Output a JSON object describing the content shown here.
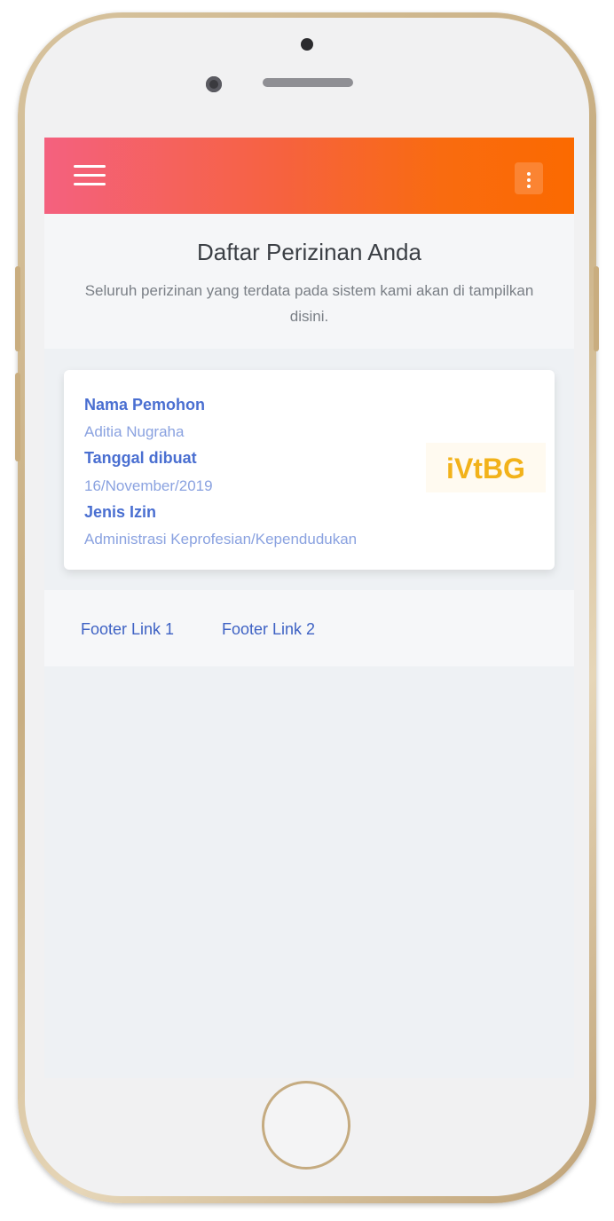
{
  "page": {
    "title": "Daftar Perizinan Anda",
    "subtitle": "Seluruh perizinan yang terdata pada sistem kami akan di tampilkan disini."
  },
  "card": {
    "applicant_label": "Nama Pemohon",
    "applicant_value": "Aditia Nugraha",
    "created_label": "Tanggal dibuat",
    "created_value": "16/November/2019",
    "permit_type_label": "Jenis Izin",
    "permit_type_value": "Administrasi Keprofesian/Kependudukan",
    "logo_text": "iVtBG"
  },
  "footer": {
    "links": [
      "Footer Link 1",
      "Footer Link 2"
    ]
  },
  "icons": {
    "menu": "hamburger-menu-icon",
    "more": "more-vertical-icon"
  },
  "colors": {
    "topbar_gradient_start": "#f4617f",
    "topbar_gradient_end": "#fb6a00",
    "label_blue": "#4a6fd1",
    "value_blue": "#8aa2e0",
    "logo_yellow": "#f2b21a"
  }
}
